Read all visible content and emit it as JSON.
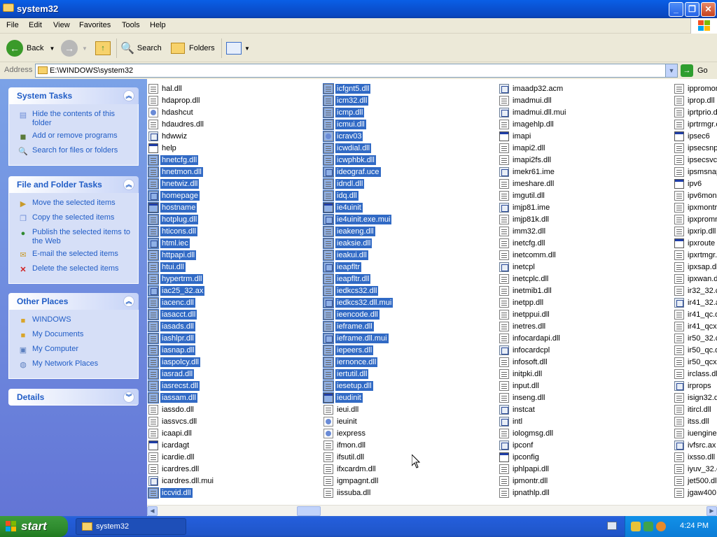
{
  "window": {
    "title": "system32"
  },
  "menu": [
    "File",
    "Edit",
    "View",
    "Favorites",
    "Tools",
    "Help"
  ],
  "toolbar": {
    "back": "Back",
    "search": "Search",
    "folders": "Folders"
  },
  "address": {
    "label": "Address",
    "value": "E:\\WINDOWS\\system32",
    "go": "Go"
  },
  "tasks": {
    "system": {
      "title": "System Tasks",
      "items": [
        "Hide the contents of this folder",
        "Add or remove programs",
        "Search for files or folders"
      ]
    },
    "file": {
      "title": "File and Folder Tasks",
      "items": [
        "Move the selected items",
        "Copy the selected items",
        "Publish the selected items to the Web",
        "E-mail the selected items",
        "Delete the selected items"
      ]
    },
    "other": {
      "title": "Other Places",
      "items": [
        "WINDOWS",
        "My Documents",
        "My Computer",
        "My Network Places"
      ]
    },
    "details": {
      "title": "Details"
    }
  },
  "files": {
    "col1": [
      {
        "name": "hal.dll",
        "type": "dll",
        "sel": false
      },
      {
        "name": "hdaprop.dll",
        "type": "dll",
        "sel": false
      },
      {
        "name": "hdashcut",
        "type": "shortcut",
        "sel": false
      },
      {
        "name": "hdaudres.dll",
        "type": "dll",
        "sel": false
      },
      {
        "name": "hdwwiz",
        "type": "other",
        "sel": false
      },
      {
        "name": "help",
        "type": "exe",
        "sel": false
      },
      {
        "name": "hnetcfg.dll",
        "type": "dll",
        "sel": true
      },
      {
        "name": "hnetmon.dll",
        "type": "dll",
        "sel": true
      },
      {
        "name": "hnetwiz.dll",
        "type": "dll",
        "sel": true
      },
      {
        "name": "homepage",
        "type": "other",
        "sel": true
      },
      {
        "name": "hostname",
        "type": "exe",
        "sel": true
      },
      {
        "name": "hotplug.dll",
        "type": "dll",
        "sel": true
      },
      {
        "name": "hticons.dll",
        "type": "dll",
        "sel": true
      },
      {
        "name": "html.iec",
        "type": "other",
        "sel": true
      },
      {
        "name": "httpapi.dll",
        "type": "dll",
        "sel": true
      },
      {
        "name": "htui.dll",
        "type": "dll",
        "sel": true
      },
      {
        "name": "hypertrm.dll",
        "type": "dll",
        "sel": true
      },
      {
        "name": "iac25_32.ax",
        "type": "other",
        "sel": true
      },
      {
        "name": "iacenc.dll",
        "type": "dll",
        "sel": true
      },
      {
        "name": "iasacct.dll",
        "type": "dll",
        "sel": true
      },
      {
        "name": "iasads.dll",
        "type": "dll",
        "sel": true
      },
      {
        "name": "iashlpr.dll",
        "type": "dll",
        "sel": true
      },
      {
        "name": "iasnap.dll",
        "type": "dll",
        "sel": true
      },
      {
        "name": "iaspolcy.dll",
        "type": "dll",
        "sel": true
      },
      {
        "name": "iasrad.dll",
        "type": "dll",
        "sel": true
      },
      {
        "name": "iasrecst.dll",
        "type": "dll",
        "sel": true
      },
      {
        "name": "iassam.dll",
        "type": "dll",
        "sel": true
      },
      {
        "name": "iassdo.dll",
        "type": "dll",
        "sel": false
      },
      {
        "name": "iassvcs.dll",
        "type": "dll",
        "sel": false
      },
      {
        "name": "icaapi.dll",
        "type": "dll",
        "sel": false
      },
      {
        "name": "icardagt",
        "type": "exe",
        "sel": false
      },
      {
        "name": "icardie.dll",
        "type": "dll",
        "sel": false
      },
      {
        "name": "icardres.dll",
        "type": "dll",
        "sel": false
      },
      {
        "name": "icardres.dll.mui",
        "type": "other",
        "sel": false
      },
      {
        "name": "iccvid.dll",
        "type": "dll",
        "sel": true
      }
    ],
    "col2": [
      {
        "name": "icfgnt5.dll",
        "type": "dll",
        "sel": true
      },
      {
        "name": "icm32.dll",
        "type": "dll",
        "sel": true
      },
      {
        "name": "icmp.dll",
        "type": "dll",
        "sel": true
      },
      {
        "name": "icmui.dll",
        "type": "dll",
        "sel": true
      },
      {
        "name": "icrav03",
        "type": "shortcut",
        "sel": true
      },
      {
        "name": "icwdial.dll",
        "type": "dll",
        "sel": true
      },
      {
        "name": "icwphbk.dll",
        "type": "dll",
        "sel": true
      },
      {
        "name": "ideograf.uce",
        "type": "other",
        "sel": true
      },
      {
        "name": "idndl.dll",
        "type": "dll",
        "sel": true
      },
      {
        "name": "idq.dll",
        "type": "dll",
        "sel": true
      },
      {
        "name": "ie4uinit",
        "type": "exe",
        "sel": true
      },
      {
        "name": "ie4uinit.exe.mui",
        "type": "other",
        "sel": true
      },
      {
        "name": "ieakeng.dll",
        "type": "dll",
        "sel": true
      },
      {
        "name": "ieaksie.dll",
        "type": "dll",
        "sel": true
      },
      {
        "name": "ieakui.dll",
        "type": "dll",
        "sel": true
      },
      {
        "name": "ieapfltr",
        "type": "other",
        "sel": true
      },
      {
        "name": "ieapfltr.dll",
        "type": "dll",
        "sel": true
      },
      {
        "name": "iedkcs32.dll",
        "type": "dll",
        "sel": true
      },
      {
        "name": "iedkcs32.dll.mui",
        "type": "other",
        "sel": true
      },
      {
        "name": "ieencode.dll",
        "type": "dll",
        "sel": true
      },
      {
        "name": "ieframe.dll",
        "type": "dll",
        "sel": true
      },
      {
        "name": "ieframe.dll.mui",
        "type": "other",
        "sel": true
      },
      {
        "name": "iepeers.dll",
        "type": "dll",
        "sel": true
      },
      {
        "name": "iernonce.dll",
        "type": "dll",
        "sel": true
      },
      {
        "name": "iertutil.dll",
        "type": "dll",
        "sel": true
      },
      {
        "name": "iesetup.dll",
        "type": "dll",
        "sel": true
      },
      {
        "name": "ieudinit",
        "type": "exe",
        "sel": true
      },
      {
        "name": "ieui.dll",
        "type": "dll",
        "sel": false
      },
      {
        "name": "ieuinit",
        "type": "shortcut",
        "sel": false
      },
      {
        "name": "iexpress",
        "type": "shortcut",
        "sel": false
      },
      {
        "name": "ifmon.dll",
        "type": "dll",
        "sel": false
      },
      {
        "name": "ifsutil.dll",
        "type": "dll",
        "sel": false
      },
      {
        "name": "ifxcardm.dll",
        "type": "dll",
        "sel": false
      },
      {
        "name": "igmpagnt.dll",
        "type": "dll",
        "sel": false
      },
      {
        "name": "iissuba.dll",
        "type": "dll",
        "sel": false
      }
    ],
    "col3": [
      {
        "name": "imaadp32.acm",
        "type": "other",
        "sel": false
      },
      {
        "name": "imadmui.dll",
        "type": "dll",
        "sel": false
      },
      {
        "name": "imadmui.dll.mui",
        "type": "other",
        "sel": false
      },
      {
        "name": "imagehlp.dll",
        "type": "dll",
        "sel": false
      },
      {
        "name": "imapi",
        "type": "exe",
        "sel": false
      },
      {
        "name": "imapi2.dll",
        "type": "dll",
        "sel": false
      },
      {
        "name": "imapi2fs.dll",
        "type": "dll",
        "sel": false
      },
      {
        "name": "imekr61.ime",
        "type": "other",
        "sel": false
      },
      {
        "name": "imeshare.dll",
        "type": "dll",
        "sel": false
      },
      {
        "name": "imgutil.dll",
        "type": "dll",
        "sel": false
      },
      {
        "name": "imjp81.ime",
        "type": "other",
        "sel": false
      },
      {
        "name": "imjp81k.dll",
        "type": "dll",
        "sel": false
      },
      {
        "name": "imm32.dll",
        "type": "dll",
        "sel": false
      },
      {
        "name": "inetcfg.dll",
        "type": "dll",
        "sel": false
      },
      {
        "name": "inetcomm.dll",
        "type": "dll",
        "sel": false
      },
      {
        "name": "inetcpl",
        "type": "other",
        "sel": false
      },
      {
        "name": "inetcplc.dll",
        "type": "dll",
        "sel": false
      },
      {
        "name": "inetmib1.dll",
        "type": "dll",
        "sel": false
      },
      {
        "name": "inetpp.dll",
        "type": "dll",
        "sel": false
      },
      {
        "name": "inetppui.dll",
        "type": "dll",
        "sel": false
      },
      {
        "name": "inetres.dll",
        "type": "dll",
        "sel": false
      },
      {
        "name": "infocardapi.dll",
        "type": "dll",
        "sel": false
      },
      {
        "name": "infocardcpl",
        "type": "other",
        "sel": false
      },
      {
        "name": "infosoft.dll",
        "type": "dll",
        "sel": false
      },
      {
        "name": "initpki.dll",
        "type": "dll",
        "sel": false
      },
      {
        "name": "input.dll",
        "type": "dll",
        "sel": false
      },
      {
        "name": "inseng.dll",
        "type": "dll",
        "sel": false
      },
      {
        "name": "instcat",
        "type": "other",
        "sel": false
      },
      {
        "name": "intl",
        "type": "other",
        "sel": false
      },
      {
        "name": "iologmsg.dll",
        "type": "dll",
        "sel": false
      },
      {
        "name": "ipconf",
        "type": "other",
        "sel": false
      },
      {
        "name": "ipconfig",
        "type": "exe",
        "sel": false
      },
      {
        "name": "iphlpapi.dll",
        "type": "dll",
        "sel": false
      },
      {
        "name": "ipmontr.dll",
        "type": "dll",
        "sel": false
      },
      {
        "name": "ipnathlp.dll",
        "type": "dll",
        "sel": false
      }
    ],
    "col4": [
      {
        "name": "ippromon",
        "type": "dll",
        "sel": false
      },
      {
        "name": "iprop.dll",
        "type": "dll",
        "sel": false
      },
      {
        "name": "iprtprio.dl",
        "type": "dll",
        "sel": false
      },
      {
        "name": "iprtrmgr.c",
        "type": "dll",
        "sel": false
      },
      {
        "name": "ipsec6",
        "type": "exe",
        "sel": false
      },
      {
        "name": "ipsecsnp.",
        "type": "dll",
        "sel": false
      },
      {
        "name": "ipsecsvc.c",
        "type": "dll",
        "sel": false
      },
      {
        "name": "ipsmsnap",
        "type": "dll",
        "sel": false
      },
      {
        "name": "ipv6",
        "type": "exe",
        "sel": false
      },
      {
        "name": "ipv6mon.c",
        "type": "dll",
        "sel": false
      },
      {
        "name": "ipxmontr",
        "type": "dll",
        "sel": false
      },
      {
        "name": "ipxpromn",
        "type": "dll",
        "sel": false
      },
      {
        "name": "ipxrip.dll",
        "type": "dll",
        "sel": false
      },
      {
        "name": "ipxroute",
        "type": "exe",
        "sel": false
      },
      {
        "name": "ipxrtmgr.",
        "type": "dll",
        "sel": false
      },
      {
        "name": "ipxsap.dl",
        "type": "dll",
        "sel": false
      },
      {
        "name": "ipxwan.d",
        "type": "dll",
        "sel": false
      },
      {
        "name": "ir32_32.c",
        "type": "dll",
        "sel": false
      },
      {
        "name": "ir41_32.a",
        "type": "other",
        "sel": false
      },
      {
        "name": "ir41_qc.d",
        "type": "dll",
        "sel": false
      },
      {
        "name": "ir41_qcx.",
        "type": "dll",
        "sel": false
      },
      {
        "name": "ir50_32.c",
        "type": "dll",
        "sel": false
      },
      {
        "name": "ir50_qc.d",
        "type": "dll",
        "sel": false
      },
      {
        "name": "ir50_qcx.",
        "type": "dll",
        "sel": false
      },
      {
        "name": "irclass.dll",
        "type": "dll",
        "sel": false
      },
      {
        "name": "irprops",
        "type": "other",
        "sel": false
      },
      {
        "name": "isign32.d",
        "type": "dll",
        "sel": false
      },
      {
        "name": "itircl.dll",
        "type": "dll",
        "sel": false
      },
      {
        "name": "itss.dll",
        "type": "dll",
        "sel": false
      },
      {
        "name": "iuengine.",
        "type": "dll",
        "sel": false
      },
      {
        "name": "ivfsrc.ax",
        "type": "other",
        "sel": false
      },
      {
        "name": "ixsso.dll",
        "type": "dll",
        "sel": false
      },
      {
        "name": "iyuv_32.c",
        "type": "dll",
        "sel": false
      },
      {
        "name": "jet500.dl",
        "type": "dll",
        "sel": false
      },
      {
        "name": "jgaw400.",
        "type": "dll",
        "sel": false
      }
    ]
  },
  "taskbar": {
    "start": "start",
    "window_button": "system32",
    "clock": "4:24 PM"
  },
  "colors": {
    "selection": "#316ac5",
    "titlebar": "#0a53d4",
    "taskpane": "#6375d6"
  }
}
